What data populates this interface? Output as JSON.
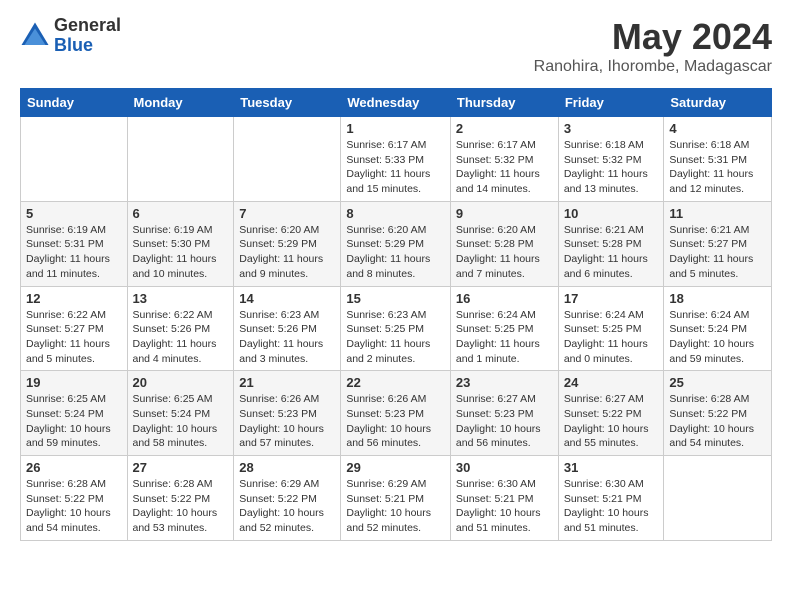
{
  "logo": {
    "general": "General",
    "blue": "Blue"
  },
  "title": "May 2024",
  "subtitle": "Ranohira, Ihorombe, Madagascar",
  "days_header": [
    "Sunday",
    "Monday",
    "Tuesday",
    "Wednesday",
    "Thursday",
    "Friday",
    "Saturday"
  ],
  "weeks": [
    [
      {
        "day": "",
        "info": ""
      },
      {
        "day": "",
        "info": ""
      },
      {
        "day": "",
        "info": ""
      },
      {
        "day": "1",
        "info": "Sunrise: 6:17 AM\nSunset: 5:33 PM\nDaylight: 11 hours\nand 15 minutes."
      },
      {
        "day": "2",
        "info": "Sunrise: 6:17 AM\nSunset: 5:32 PM\nDaylight: 11 hours\nand 14 minutes."
      },
      {
        "day": "3",
        "info": "Sunrise: 6:18 AM\nSunset: 5:32 PM\nDaylight: 11 hours\nand 13 minutes."
      },
      {
        "day": "4",
        "info": "Sunrise: 6:18 AM\nSunset: 5:31 PM\nDaylight: 11 hours\nand 12 minutes."
      }
    ],
    [
      {
        "day": "5",
        "info": "Sunrise: 6:19 AM\nSunset: 5:31 PM\nDaylight: 11 hours\nand 11 minutes."
      },
      {
        "day": "6",
        "info": "Sunrise: 6:19 AM\nSunset: 5:30 PM\nDaylight: 11 hours\nand 10 minutes."
      },
      {
        "day": "7",
        "info": "Sunrise: 6:20 AM\nSunset: 5:29 PM\nDaylight: 11 hours\nand 9 minutes."
      },
      {
        "day": "8",
        "info": "Sunrise: 6:20 AM\nSunset: 5:29 PM\nDaylight: 11 hours\nand 8 minutes."
      },
      {
        "day": "9",
        "info": "Sunrise: 6:20 AM\nSunset: 5:28 PM\nDaylight: 11 hours\nand 7 minutes."
      },
      {
        "day": "10",
        "info": "Sunrise: 6:21 AM\nSunset: 5:28 PM\nDaylight: 11 hours\nand 6 minutes."
      },
      {
        "day": "11",
        "info": "Sunrise: 6:21 AM\nSunset: 5:27 PM\nDaylight: 11 hours\nand 5 minutes."
      }
    ],
    [
      {
        "day": "12",
        "info": "Sunrise: 6:22 AM\nSunset: 5:27 PM\nDaylight: 11 hours\nand 5 minutes."
      },
      {
        "day": "13",
        "info": "Sunrise: 6:22 AM\nSunset: 5:26 PM\nDaylight: 11 hours\nand 4 minutes."
      },
      {
        "day": "14",
        "info": "Sunrise: 6:23 AM\nSunset: 5:26 PM\nDaylight: 11 hours\nand 3 minutes."
      },
      {
        "day": "15",
        "info": "Sunrise: 6:23 AM\nSunset: 5:25 PM\nDaylight: 11 hours\nand 2 minutes."
      },
      {
        "day": "16",
        "info": "Sunrise: 6:24 AM\nSunset: 5:25 PM\nDaylight: 11 hours\nand 1 minute."
      },
      {
        "day": "17",
        "info": "Sunrise: 6:24 AM\nSunset: 5:25 PM\nDaylight: 11 hours\nand 0 minutes."
      },
      {
        "day": "18",
        "info": "Sunrise: 6:24 AM\nSunset: 5:24 PM\nDaylight: 10 hours\nand 59 minutes."
      }
    ],
    [
      {
        "day": "19",
        "info": "Sunrise: 6:25 AM\nSunset: 5:24 PM\nDaylight: 10 hours\nand 59 minutes."
      },
      {
        "day": "20",
        "info": "Sunrise: 6:25 AM\nSunset: 5:24 PM\nDaylight: 10 hours\nand 58 minutes."
      },
      {
        "day": "21",
        "info": "Sunrise: 6:26 AM\nSunset: 5:23 PM\nDaylight: 10 hours\nand 57 minutes."
      },
      {
        "day": "22",
        "info": "Sunrise: 6:26 AM\nSunset: 5:23 PM\nDaylight: 10 hours\nand 56 minutes."
      },
      {
        "day": "23",
        "info": "Sunrise: 6:27 AM\nSunset: 5:23 PM\nDaylight: 10 hours\nand 56 minutes."
      },
      {
        "day": "24",
        "info": "Sunrise: 6:27 AM\nSunset: 5:22 PM\nDaylight: 10 hours\nand 55 minutes."
      },
      {
        "day": "25",
        "info": "Sunrise: 6:28 AM\nSunset: 5:22 PM\nDaylight: 10 hours\nand 54 minutes."
      }
    ],
    [
      {
        "day": "26",
        "info": "Sunrise: 6:28 AM\nSunset: 5:22 PM\nDaylight: 10 hours\nand 54 minutes."
      },
      {
        "day": "27",
        "info": "Sunrise: 6:28 AM\nSunset: 5:22 PM\nDaylight: 10 hours\nand 53 minutes."
      },
      {
        "day": "28",
        "info": "Sunrise: 6:29 AM\nSunset: 5:22 PM\nDaylight: 10 hours\nand 52 minutes."
      },
      {
        "day": "29",
        "info": "Sunrise: 6:29 AM\nSunset: 5:21 PM\nDaylight: 10 hours\nand 52 minutes."
      },
      {
        "day": "30",
        "info": "Sunrise: 6:30 AM\nSunset: 5:21 PM\nDaylight: 10 hours\nand 51 minutes."
      },
      {
        "day": "31",
        "info": "Sunrise: 6:30 AM\nSunset: 5:21 PM\nDaylight: 10 hours\nand 51 minutes."
      },
      {
        "day": "",
        "info": ""
      }
    ]
  ]
}
